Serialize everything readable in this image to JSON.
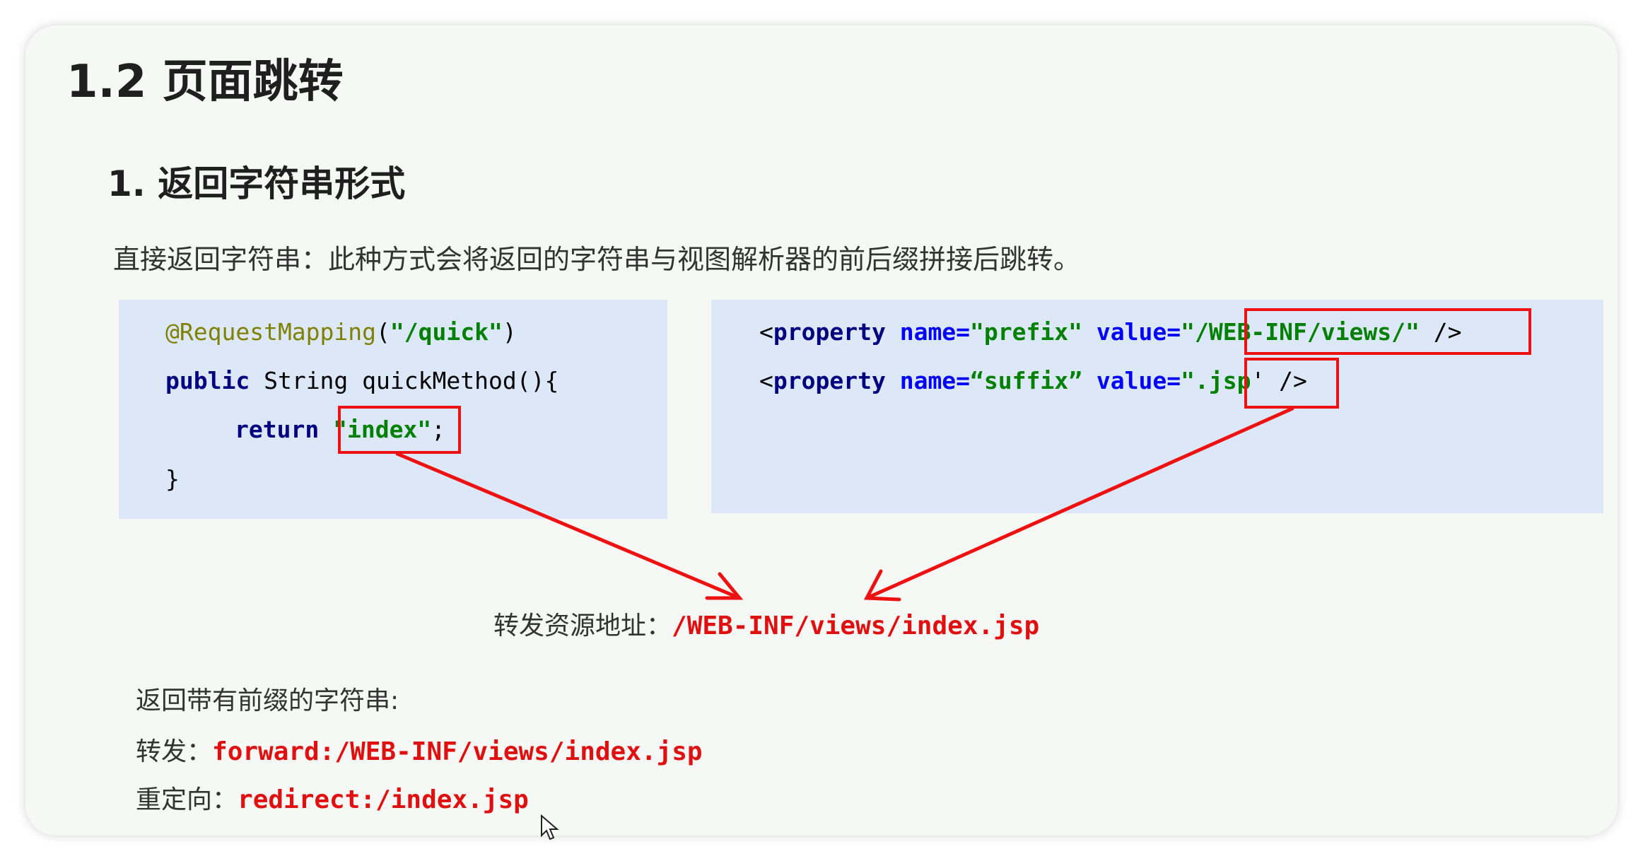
{
  "heading": "1.2 页面跳转",
  "subheading": "1. 返回字符串形式",
  "description": "直接返回字符串：此种方式会将返回的字符串与视图解析器的前后缀拼接后跳转。",
  "java_code": {
    "line1_anno": "@RequestMapping",
    "line1_paren_open": "(",
    "line1_str": "\"/quick\"",
    "line1_paren_close": ")",
    "line2_kw": "public",
    "line2_rest": " String quickMethod(){",
    "line3_kw": "return",
    "line3_str": "\"index\"",
    "line3_end": ";",
    "line4": "}"
  },
  "xml_code": {
    "line1_open": "<",
    "line1_tag": "property",
    "line1_name_attr": "name=",
    "line1_name_val": "\"prefix\"",
    "line1_value_attr": "value=",
    "line1_value_val": "\"/WEB-INF/views/\"",
    "line1_close": " />",
    "line2_open": "<",
    "line2_tag": "property",
    "line2_name_attr": "name=",
    "line2_name_val": "“suffix”",
    "line2_value_attr": "value=",
    "line2_value_val": "\".jsp",
    "line2_close": "' />"
  },
  "forward_resource": {
    "label": "转发资源地址：",
    "path": "/WEB-INF/views/index.jsp"
  },
  "prefix_section": {
    "title": "返回带有前缀的字符串:",
    "forward_label": "转发：",
    "forward_value": "forward:/WEB-INF/views/index.jsp",
    "redirect_label": "重定向：",
    "redirect_value": "redirect:/index.jsp"
  },
  "colors": {
    "highlight": "#ee1111",
    "code_bg": "#dce7f8",
    "card_bg": "#f5f8f4"
  }
}
